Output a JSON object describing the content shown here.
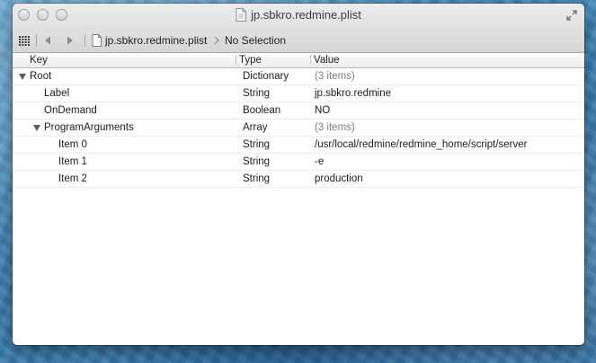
{
  "window": {
    "title": "jp.sbkro.redmine.plist"
  },
  "nav": {
    "file": "jp.sbkro.redmine.plist",
    "selection": "No Selection"
  },
  "columns": {
    "key": "Key",
    "type": "Type",
    "value": "Value"
  },
  "rows": [
    {
      "key": "Root",
      "type": "Dictionary",
      "value": "(3 items)",
      "depth": 0,
      "expandable": true,
      "muted": true
    },
    {
      "key": "Label",
      "type": "String",
      "value": "jp.sbkro.redmine",
      "depth": 1,
      "expandable": false,
      "muted": false
    },
    {
      "key": "OnDemand",
      "type": "Boolean",
      "value": "NO",
      "depth": 1,
      "expandable": false,
      "muted": false
    },
    {
      "key": "ProgramArguments",
      "type": "Array",
      "value": "(3 items)",
      "depth": 1,
      "expandable": true,
      "muted": true
    },
    {
      "key": "Item 0",
      "type": "String",
      "value": "/usr/local/redmine/redmine_home/script/server",
      "depth": 2,
      "expandable": false,
      "muted": false
    },
    {
      "key": "Item 1",
      "type": "String",
      "value": "-e",
      "depth": 2,
      "expandable": false,
      "muted": false
    },
    {
      "key": "Item 2",
      "type": "String",
      "value": "production",
      "depth": 2,
      "expandable": false,
      "muted": false
    }
  ]
}
